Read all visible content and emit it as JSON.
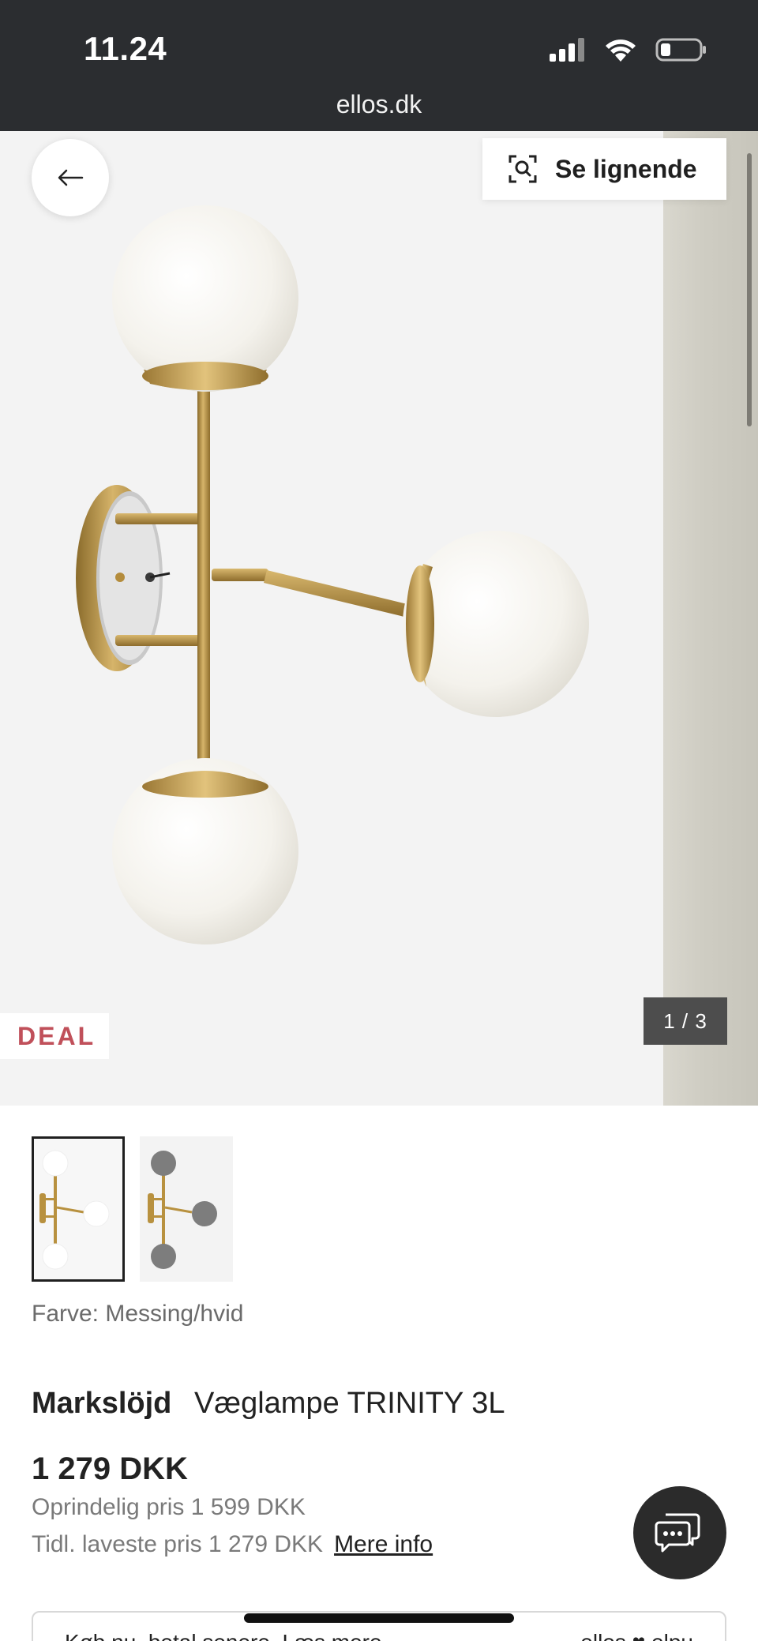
{
  "status_bar": {
    "time": "11.24",
    "icons": [
      "signal-icon",
      "wifi-icon",
      "battery-icon"
    ]
  },
  "browser": {
    "url": "ellos.dk"
  },
  "gallery": {
    "similar_label": "Se lignende",
    "deal_badge": "DEAL",
    "counter": "1 / 3",
    "background_color": "#f3f3f3"
  },
  "product": {
    "color_label": "Farve: Messing/hvid",
    "brand": "Markslöjd",
    "name": "Væglampe TRINITY 3L",
    "price": "1 279 DKK",
    "original_price": "Oprindelig pris 1 599 DKK",
    "lowest_price": "Tidl. laveste pris 1 279 DKK",
    "more_info": "Mere info"
  },
  "bnpl": {
    "text": "Køb nu, betal senere. Læs mere",
    "brand": "ellos ♥ elpu"
  },
  "colors": {
    "brass": "#b8913f",
    "deal_red": "#c0505a",
    "dark": "#2b2d30"
  }
}
